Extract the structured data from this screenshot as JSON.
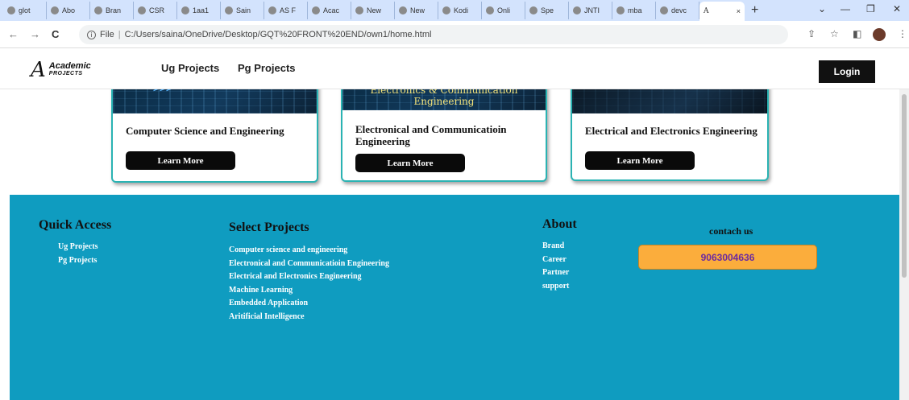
{
  "browser": {
    "tabs": [
      {
        "label": "glot",
        "icon": "google-icon"
      },
      {
        "label": "Abo",
        "icon": "google-icon"
      },
      {
        "label": "Bran",
        "icon": "google-icon"
      },
      {
        "label": "CSR",
        "icon": "google-icon"
      },
      {
        "label": "1aa1",
        "icon": "web-icon"
      },
      {
        "label": "Sain",
        "icon": "web-icon"
      },
      {
        "label": "AS F",
        "icon": "academic-icon"
      },
      {
        "label": "Acac",
        "icon": "web-icon"
      },
      {
        "label": "New",
        "icon": "web-icon"
      },
      {
        "label": "New",
        "icon": "web-icon"
      },
      {
        "label": "Kodi",
        "icon": "web-icon"
      },
      {
        "label": "Onli",
        "icon": "web-icon"
      },
      {
        "label": "Spe",
        "icon": "web-icon"
      },
      {
        "label": "JNTI",
        "icon": "web-icon"
      },
      {
        "label": "mba",
        "icon": "google-icon"
      },
      {
        "label": "devc",
        "icon": "google-icon"
      }
    ],
    "active_tab": {
      "label": "A",
      "close": "×"
    },
    "new_tab": "+",
    "window_controls": {
      "minimize": "—",
      "restore": "❐",
      "close": "✕",
      "tabsearch": "⌄"
    },
    "nav": {
      "back": "←",
      "forward": "→",
      "reload": "C"
    },
    "address": {
      "scheme_label": "File",
      "url": "C:/Users/saina/OneDrive/Desktop/GQT%20FRONT%20END/own1/home.html"
    }
  },
  "site": {
    "logo": {
      "mark": "A",
      "line1": "Academic",
      "line2": "PROJECTS"
    },
    "nav_links": [
      "Ug Projects",
      "Pg Projects"
    ],
    "login_label": "Login",
    "cards": [
      {
        "title": "Computer Science and Engineering",
        "button": "Learn More",
        "image_text": ">>>"
      },
      {
        "title": "Electronical and Communicatioin Engineering",
        "button": "Learn More",
        "image_text": "Electronics & Communication Engineering"
      },
      {
        "title": "Electrical and Electronics Engineering",
        "button": "Learn More",
        "image_text": ""
      }
    ],
    "footer": {
      "quick_access": {
        "heading": "Quick Access",
        "links": [
          "Ug Projects",
          "Pg Projects"
        ]
      },
      "select_projects": {
        "heading": "Select Projects",
        "links": [
          "Computer science and engineering",
          "Electronical and Communicatioin Engineering",
          "Electrical and Electronics Engineering",
          "Machine Learning",
          "Embedded Application",
          "Aritificial Intelligence"
        ]
      },
      "about": {
        "heading": "About",
        "links": [
          "Brand",
          "Career",
          "Partner",
          "support"
        ]
      },
      "contact": {
        "heading": "contach us",
        "phone": "9063004636"
      }
    }
  },
  "colors": {
    "footer_bg": "#0f9cc0",
    "card_border": "#2ab3b3",
    "contact_btn": "#fbad3c",
    "phone_text": "#6b2aa0"
  }
}
